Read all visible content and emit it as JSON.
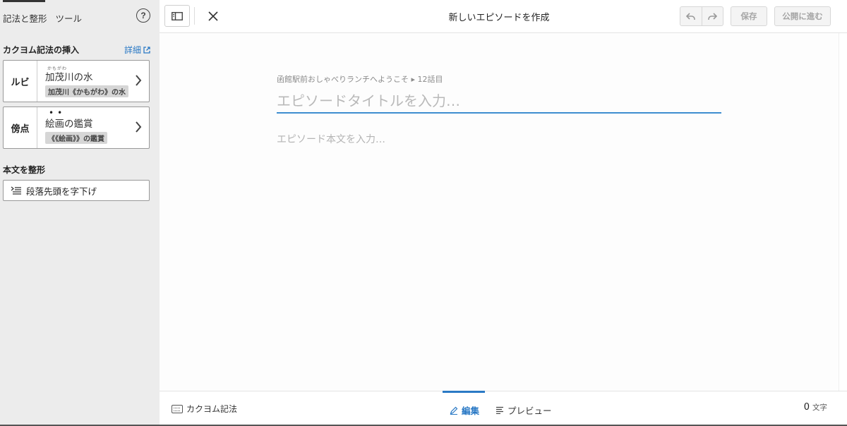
{
  "sidebar": {
    "tabs": [
      {
        "label": "記法と整形"
      },
      {
        "label": "ツール"
      }
    ],
    "help_label": "?",
    "notation": {
      "title": "カクヨム記法の挿入",
      "detail_link": "詳細",
      "ruby": {
        "label": "ルビ",
        "sample": "加茂川の水",
        "ruby_text": "かもがわ",
        "code": "加茂川《かもがわ》の水"
      },
      "emphasis": {
        "label": "傍点",
        "sample": "絵画の鑑賞",
        "code": "《《絵画》》の鑑賞"
      }
    },
    "format": {
      "title": "本文を整形",
      "indent_label": "段落先頭を字下げ"
    }
  },
  "header": {
    "title": "新しいエピソードを作成",
    "save_label": "保存",
    "publish_label": "公開に進む"
  },
  "editor": {
    "meta": "函館駅前おしゃべりランチへようこそ ▸ 12話目",
    "title_placeholder": "エピソードタイトルを入力…",
    "body_placeholder": "エピソード本文を入力…"
  },
  "footer": {
    "notation_label": "カクヨム記法",
    "tab_edit": "編集",
    "tab_preview": "プレビュー",
    "char_count": "0",
    "char_unit": "文字"
  },
  "colors": {
    "accent": "#2a79c5",
    "sidebar_bg": "#ececec",
    "title_underline": "#3e8ed0"
  }
}
